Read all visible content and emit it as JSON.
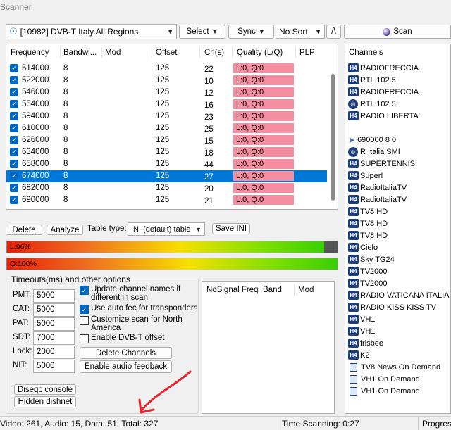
{
  "window": {
    "title": "Scanner"
  },
  "toolbar": {
    "transponder_list": "[10982] DVB-T Italy.All Regions",
    "select_label": "Select",
    "sync_label": "Sync",
    "sort_value": "No Sort",
    "slash_label": "/\\",
    "scan_label": "Scan"
  },
  "table": {
    "headers": {
      "frequency": "Frequency",
      "bandwidth": "Bandwi...",
      "mod": "Mod",
      "offset": "Offset",
      "chs": "Ch(s)",
      "quality": "Quality (L/Q)",
      "plp": "PLP"
    },
    "rows": [
      {
        "freq": "514000",
        "bw": "8",
        "offset": "125",
        "ch": "22",
        "quality": "L:0, Q:0"
      },
      {
        "freq": "522000",
        "bw": "8",
        "offset": "125",
        "ch": "10",
        "quality": "L:0, Q:0"
      },
      {
        "freq": "546000",
        "bw": "8",
        "offset": "125",
        "ch": "12",
        "quality": "L:0, Q:0"
      },
      {
        "freq": "554000",
        "bw": "8",
        "offset": "125",
        "ch": "16",
        "quality": "L:0, Q:0"
      },
      {
        "freq": "594000",
        "bw": "8",
        "offset": "125",
        "ch": "23",
        "quality": "L:0, Q:0"
      },
      {
        "freq": "610000",
        "bw": "8",
        "offset": "125",
        "ch": "25",
        "quality": "L:0, Q:0"
      },
      {
        "freq": "626000",
        "bw": "8",
        "offset": "125",
        "ch": "15",
        "quality": "L:0, Q:0"
      },
      {
        "freq": "634000",
        "bw": "8",
        "offset": "125",
        "ch": "18",
        "quality": "L:0, Q:0"
      },
      {
        "freq": "658000",
        "bw": "8",
        "offset": "125",
        "ch": "44",
        "quality": "L:0, Q:0"
      },
      {
        "freq": "674000",
        "bw": "8",
        "offset": "125",
        "ch": "27",
        "quality": "L:0, Q:0"
      },
      {
        "freq": "682000",
        "bw": "8",
        "offset": "125",
        "ch": "20",
        "quality": "L:0, Q:0"
      },
      {
        "freq": "690000",
        "bw": "8",
        "offset": "125",
        "ch": "21",
        "quality": "L:0, Q:0"
      }
    ],
    "selected_index": 9
  },
  "actions": {
    "delete_label": "Delete",
    "analyze_label": "Analyze",
    "table_type_label": "Table type:",
    "table_type_value": "INI (default) table",
    "save_ini_label": "Save INI"
  },
  "meters": {
    "level_label": "L:96%",
    "level_fraction": 0.96,
    "quality_label": "Q:100%",
    "quality_fraction": 1.0
  },
  "timeouts": {
    "title": "Timeouts(ms) and other options",
    "fields": [
      {
        "label": "PMT:",
        "value": "5000"
      },
      {
        "label": "CAT:",
        "value": "5000"
      },
      {
        "label": "PAT:",
        "value": "5000"
      },
      {
        "label": "SDT:",
        "value": "7000"
      },
      {
        "label": "Lock:",
        "value": "2000"
      },
      {
        "label": "NIT:",
        "value": "5000"
      }
    ],
    "options": [
      {
        "label": "Update channel names if different in scan",
        "checked": true
      },
      {
        "label": "Use auto fec for transponders",
        "checked": true
      },
      {
        "label": "Customize scan for North America",
        "checked": false
      },
      {
        "label": "Enable DVB-T offset",
        "checked": false
      }
    ],
    "delete_channels_label": "Delete Channels",
    "audio_feedback_label": "Enable audio feedback"
  },
  "nosignal": {
    "headers": [
      "NoSignal Freq",
      "Band",
      "Mod"
    ]
  },
  "misc": {
    "diseqc_label": "Diseqc console",
    "hidden_dishnet_label": "Hidden dishnet"
  },
  "channels": {
    "header": "Channels",
    "items": [
      {
        "icon": "h4-icon",
        "name": "RADIOFRECCIA"
      },
      {
        "icon": "h4-icon",
        "name": "RTL 102.5"
      },
      {
        "icon": "h4-icon",
        "name": "RADIOFRECCIA"
      },
      {
        "icon": "radio-icon",
        "name": "RTL 102.5"
      },
      {
        "icon": "h4-icon",
        "name": "RADIO LIBERTA'"
      },
      {
        "icon": "none",
        "name": ""
      },
      {
        "icon": "arrow-icon",
        "name": "690000 8 0"
      },
      {
        "icon": "radio-icon",
        "name": "R Italia SMI"
      },
      {
        "icon": "h4-icon",
        "name": "SUPERTENNIS"
      },
      {
        "icon": "h4-icon",
        "name": "Super!"
      },
      {
        "icon": "h4-icon",
        "name": "RadioItaliaTV"
      },
      {
        "icon": "h4-icon",
        "name": "RadioItaliaTV"
      },
      {
        "icon": "h4-icon",
        "name": "TV8 HD"
      },
      {
        "icon": "h4-icon",
        "name": "TV8 HD"
      },
      {
        "icon": "h4-icon",
        "name": "TV8 HD"
      },
      {
        "icon": "h4-icon",
        "name": "Cielo"
      },
      {
        "icon": "h4-icon",
        "name": "Sky TG24"
      },
      {
        "icon": "h4-icon",
        "name": "TV2000"
      },
      {
        "icon": "h4-icon",
        "name": "TV2000"
      },
      {
        "icon": "h4-icon",
        "name": "RADIO VATICANA ITALIA"
      },
      {
        "icon": "h4-icon",
        "name": "RADIO KISS KISS TV"
      },
      {
        "icon": "h4-icon",
        "name": "VH1"
      },
      {
        "icon": "h4-icon",
        "name": "VH1"
      },
      {
        "icon": "h4-icon",
        "name": "frisbee"
      },
      {
        "icon": "h4-icon",
        "name": "K2"
      },
      {
        "icon": "document-icon",
        "name": "TV8 News On Demand"
      },
      {
        "icon": "document-icon",
        "name": "VH1 On Demand"
      },
      {
        "icon": "document-icon",
        "name": "VH1 On Demand"
      }
    ]
  },
  "status": {
    "counts": "Video: 261, Audio: 15, Data: 51, Total: 327",
    "time": "Time Scanning: 0:27",
    "progress": "Progres"
  },
  "annotation": {
    "color": "#e8202a"
  }
}
